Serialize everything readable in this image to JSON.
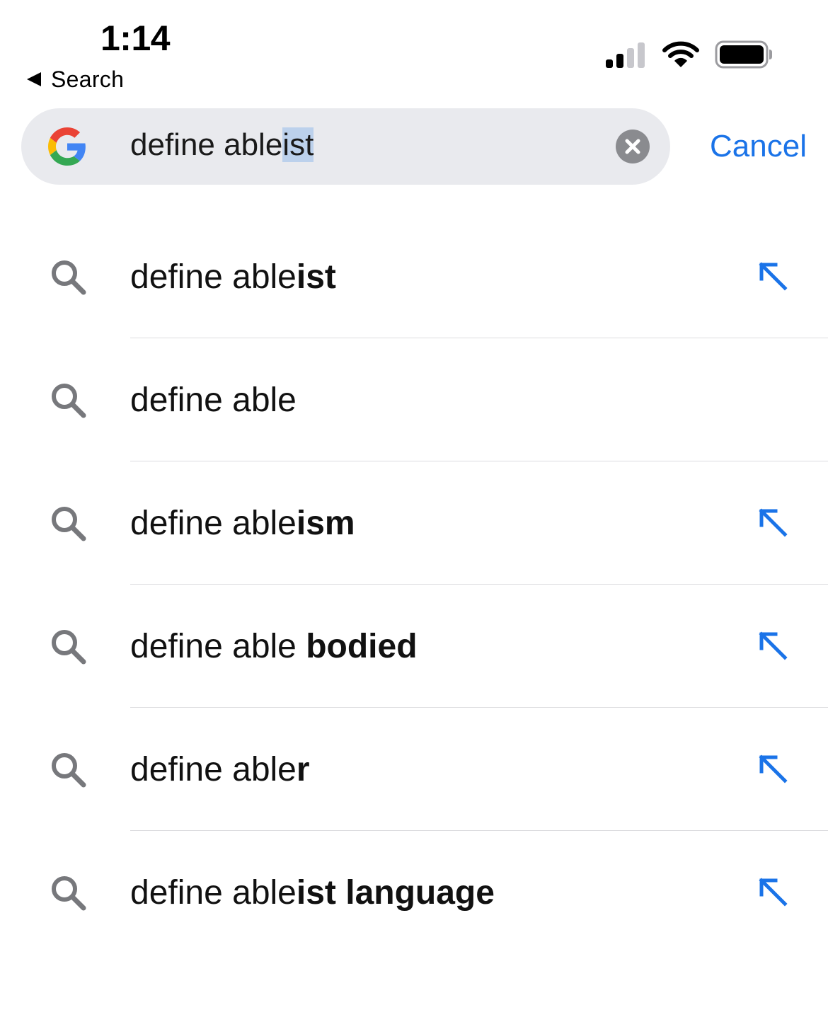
{
  "status_bar": {
    "time": "1:14",
    "back_label": "Search",
    "signal_bars_active": 2,
    "signal_bars_total": 4,
    "battery_level": 0.9
  },
  "search": {
    "query_prefix": "define able",
    "query_selected": "ist",
    "cancel_label": "Cancel",
    "logo": "google-g-icon",
    "clear_icon": "clear-circle-icon"
  },
  "suggestions": [
    {
      "normal": "define able",
      "bold": "ist",
      "fill_arrow": true
    },
    {
      "normal": "define able",
      "bold": "",
      "fill_arrow": false
    },
    {
      "normal": "define able",
      "bold": "ism",
      "fill_arrow": true
    },
    {
      "normal": "define able ",
      "bold": "bodied",
      "fill_arrow": true
    },
    {
      "normal": "define able",
      "bold": "r",
      "fill_arrow": true
    },
    {
      "normal": "define able",
      "bold": "ist language",
      "fill_arrow": true
    }
  ],
  "colors": {
    "accent": "#1a73e8",
    "field_background": "#e9eaee",
    "selection": "#bcd1ec",
    "icon_gray": "#77787c",
    "google_blue": "#4285F4",
    "google_red": "#EA4335",
    "google_yellow": "#FBBC05",
    "google_green": "#34A853"
  }
}
